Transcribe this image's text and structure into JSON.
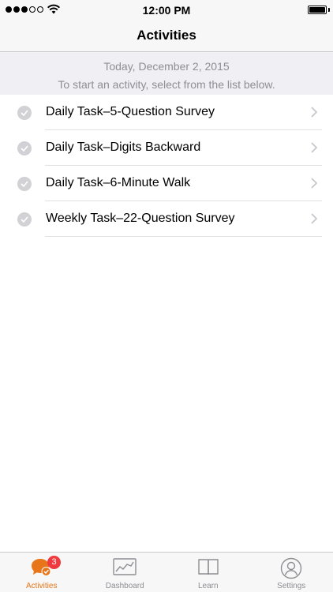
{
  "status_bar": {
    "time": "12:00 PM"
  },
  "nav": {
    "title": "Activities"
  },
  "header": {
    "date": "Today, December 2, 2015",
    "instructions": "To start an activity, select from the list below."
  },
  "activities": [
    {
      "label": "Daily Task–5-Question Survey"
    },
    {
      "label": "Daily Task–Digits Backward"
    },
    {
      "label": "Daily Task–6-Minute Walk"
    },
    {
      "label": "Weekly Task–22-Question Survey"
    }
  ],
  "tabs": [
    {
      "label": "Activities",
      "icon": "activities-icon",
      "badge": "3",
      "active": true
    },
    {
      "label": "Dashboard",
      "icon": "dashboard-icon"
    },
    {
      "label": "Learn",
      "icon": "learn-book-icon"
    },
    {
      "label": "Settings",
      "icon": "settings-person-icon"
    }
  ],
  "colors": {
    "accent": "#e8751a",
    "badge": "#ef3b3f",
    "header_bg": "#efeff4",
    "secondary_text": "#8e8e93"
  }
}
